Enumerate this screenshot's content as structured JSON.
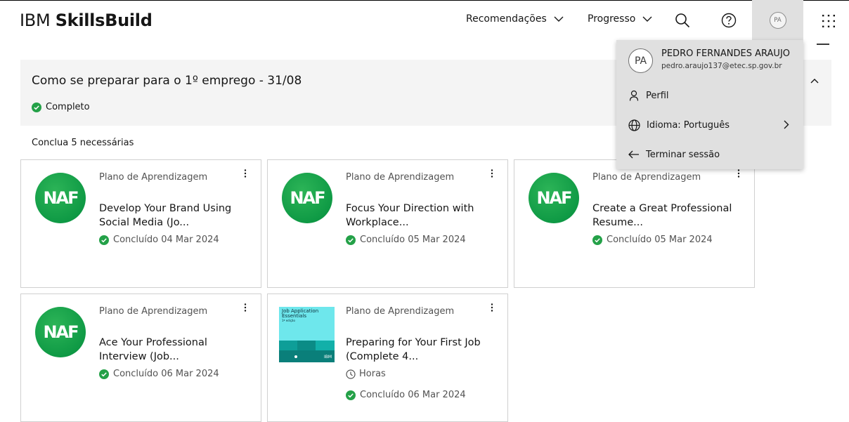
{
  "header": {
    "brand_light": "IBM ",
    "brand_bold": "SkillsBuild",
    "nav": [
      {
        "label": "Recomendações"
      },
      {
        "label": "Progresso"
      }
    ],
    "avatar_initials": "PA"
  },
  "section": {
    "title": "Como se preparar para o 1º emprego - 31/08",
    "status": "Completo",
    "required": "Conclua 5 necessárias"
  },
  "cards": [
    {
      "type": "Plano de Aprendizagem",
      "title": "Develop Your Brand Using Social Media (Jo...",
      "status": "Concluído 04 Mar 2024",
      "logo": "NAF"
    },
    {
      "type": "Plano de Aprendizagem",
      "title": "Focus Your Direction with Workplace...",
      "status": "Concluído 05 Mar 2024",
      "logo": "NAF"
    },
    {
      "type": "Plano de Aprendizagem",
      "title": "Create a Great Professional Resume...",
      "status": "Concluído 05 Mar 2024",
      "logo": "NAF"
    },
    {
      "type": "Plano de Aprendizagem",
      "title": "Ace Your Professional Interview (Job...",
      "status": "Concluído 06 Mar 2024",
      "logo": "NAF"
    },
    {
      "type": "Plano de Aprendizagem",
      "title": "Preparing for Your First Job (Complete 4...",
      "hours": "Horas",
      "status": "Concluído 06 Mar 2024",
      "thumb_title": "Job Application Essentials",
      "thumb_sub": "1ª edição",
      "thumb_brand": "IBM"
    }
  ],
  "dropdown": {
    "initials": "PA",
    "name": "PEDRO FERNANDES ARAUJO",
    "email": "pedro.araujo137@etec.sp.gov.br",
    "profile": "Perfil",
    "language": "Idioma: Português",
    "logout": "Terminar sessão"
  },
  "colors": {
    "success": "#24a148",
    "brand_green": "#0f9a45",
    "panel_bg": "#f4f4f4",
    "dropdown_bg": "#e0e0e0"
  }
}
